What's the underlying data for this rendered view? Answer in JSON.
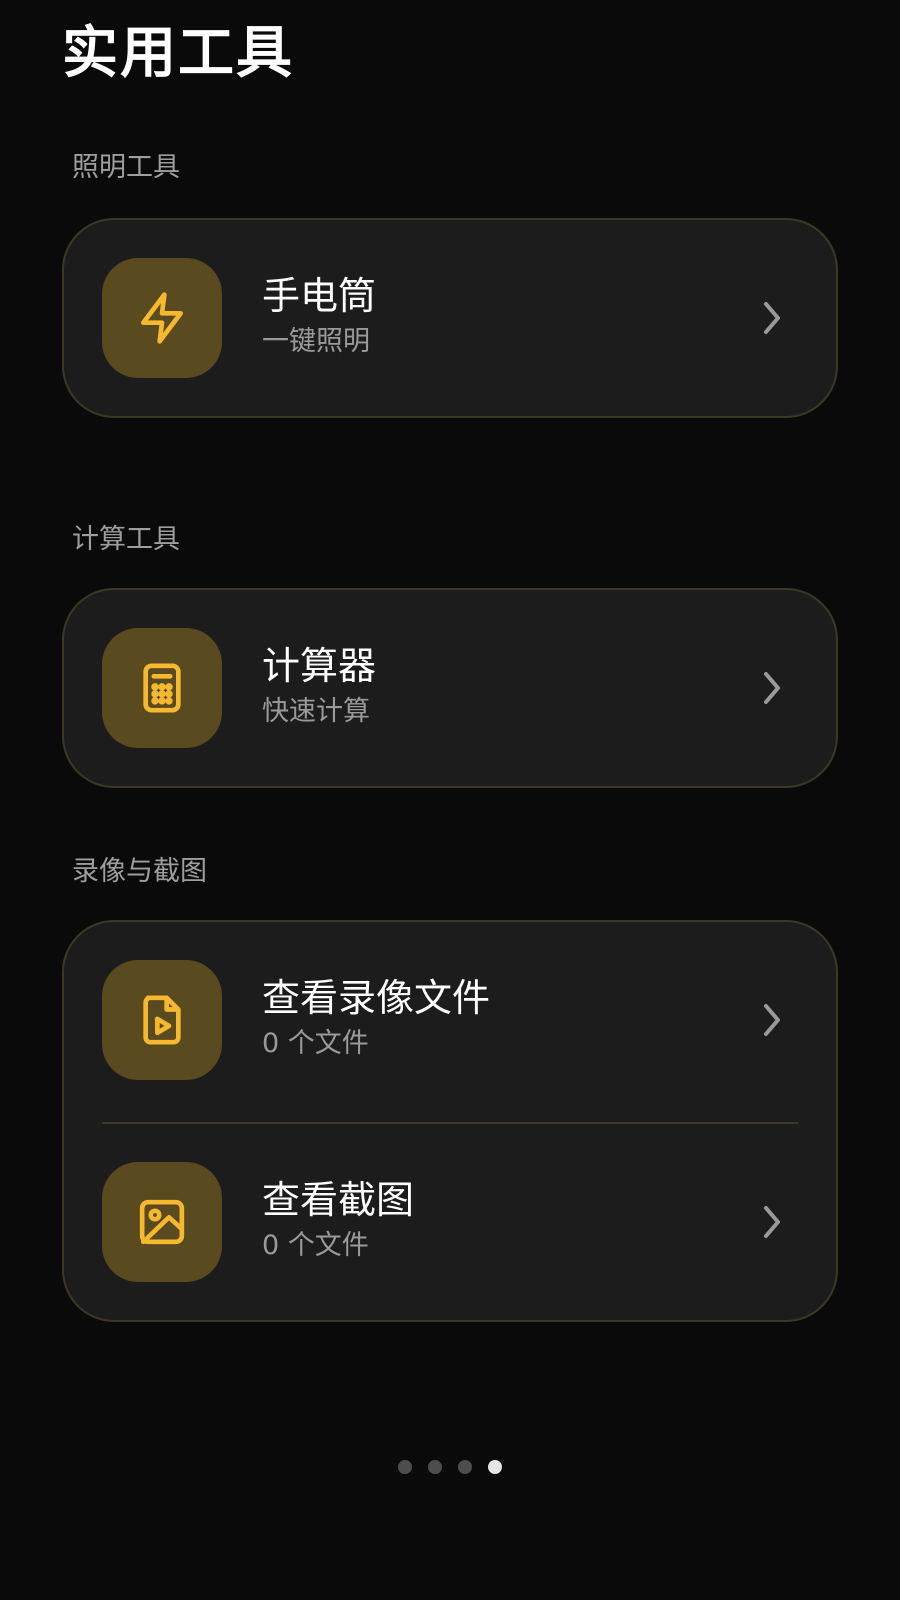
{
  "page": {
    "title": "实用工具"
  },
  "colors": {
    "accent": "#F5B82E",
    "tile": "#5A4A1F",
    "card": "#1C1C1C",
    "border": "#3D3823"
  },
  "sections": [
    {
      "label": "照明工具",
      "items": [
        {
          "icon": "lightning-icon",
          "title": "手电筒",
          "subtitle": "一键照明"
        }
      ]
    },
    {
      "label": "计算工具",
      "items": [
        {
          "icon": "calculator-icon",
          "title": "计算器",
          "subtitle": "快速计算"
        }
      ]
    },
    {
      "label": "录像与截图",
      "items": [
        {
          "icon": "video-file-icon",
          "title": "查看录像文件",
          "subtitle": "0 个文件"
        },
        {
          "icon": "image-icon",
          "title": "查看截图",
          "subtitle": "0 个文件"
        }
      ]
    }
  ],
  "pager": {
    "total": 4,
    "active_index": 3
  }
}
